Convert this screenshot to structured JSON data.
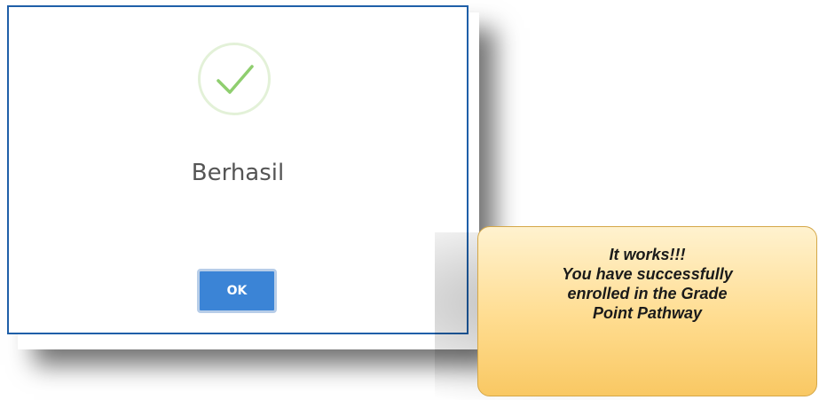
{
  "dialog": {
    "icon": "checkmark-icon",
    "title": "Berhasil",
    "ok_label": "OK",
    "accent_color": "#3b84d6",
    "border_color": "#1f5fa8",
    "check_color": "#8fce6f"
  },
  "callout": {
    "lines": [
      "It works!!!",
      "You have successfully",
      "enrolled in the Grade",
      "Point Pathway"
    ]
  }
}
